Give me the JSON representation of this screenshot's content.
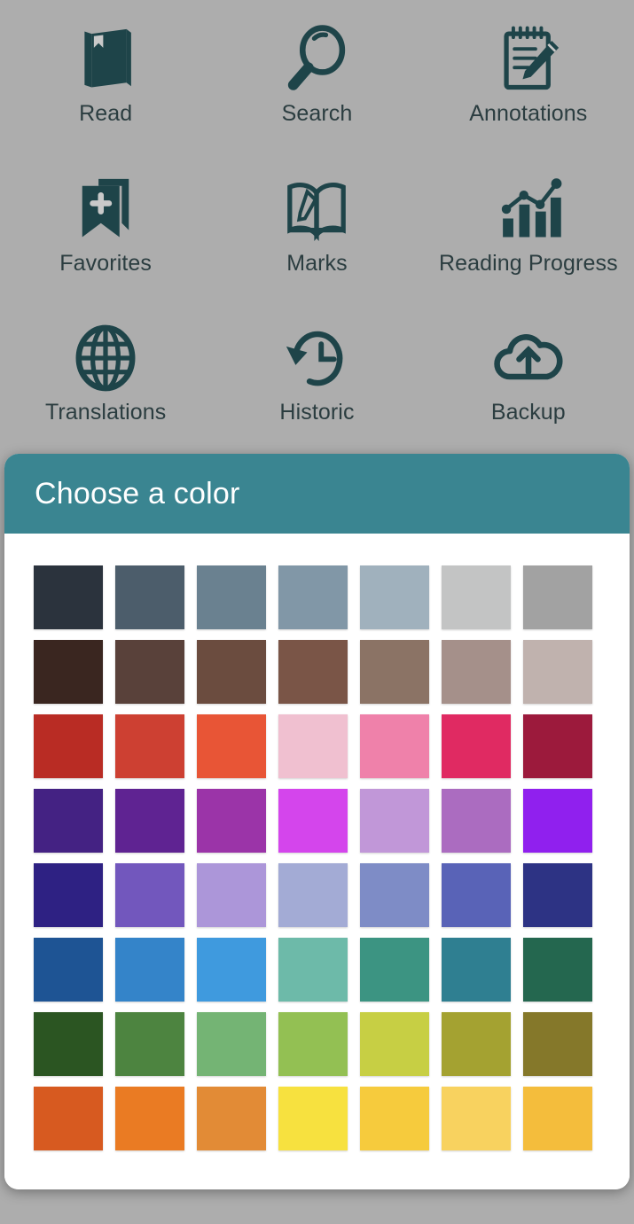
{
  "theme": {
    "background": "#adadad",
    "icon_color": "#1e4449",
    "label_color": "#2b3d40",
    "dialog_header": "#3a8591",
    "dialog_body": "#ffffff",
    "dialog_title_color": "#ffffff"
  },
  "app_menu": {
    "items": [
      {
        "label": "Read",
        "icon": "book-icon"
      },
      {
        "label": "Search",
        "icon": "magnifier-icon"
      },
      {
        "label": "Annotations",
        "icon": "notepad-pencil-icon"
      },
      {
        "label": "Favorites",
        "icon": "bookmark-plus-icon"
      },
      {
        "label": "Marks",
        "icon": "open-book-pencil-icon"
      },
      {
        "label": "Reading Progress",
        "icon": "bar-chart-trend-icon"
      },
      {
        "label": "Translations",
        "icon": "globe-icon"
      },
      {
        "label": "Historic",
        "icon": "clock-rewind-icon"
      },
      {
        "label": "Backup",
        "icon": "cloud-upload-icon"
      }
    ]
  },
  "color_dialog": {
    "title": "Choose a color",
    "columns": 7,
    "rows": 8,
    "palette": [
      [
        "#2b333d",
        "#4c5d6b",
        "#6a8190",
        "#8197a7",
        "#a0b1bd",
        "#c3c4c4",
        "#a2a2a2"
      ],
      [
        "#3a2620",
        "#59413a",
        "#6b4c3f",
        "#7a5547",
        "#8b7365",
        "#a5908a",
        "#c0b2ae"
      ],
      [
        "#b92c24",
        "#cd4032",
        "#e85536",
        "#f0c0d0",
        "#ef81aa",
        "#e02a62",
        "#9c1a3c"
      ],
      [
        "#442283",
        "#5f2392",
        "#9b34a8",
        "#d445ec",
        "#c197d8",
        "#ab6cc0",
        "#9020ee"
      ],
      [
        "#2e2183",
        "#7257bd",
        "#ac96d9",
        "#a3abd5",
        "#7e8cc6",
        "#5963b7",
        "#2d3384"
      ],
      [
        "#1e5494",
        "#3484c9",
        "#3f9ade",
        "#6dbaa9",
        "#3c9482",
        "#2f7f91",
        "#24674f"
      ],
      [
        "#2b5522",
        "#4d8440",
        "#74b474",
        "#93c053",
        "#c7cf44",
        "#a4a231",
        "#85782a"
      ],
      [
        "#d75a20",
        "#ea7b23",
        "#e28b36",
        "#f7e13f",
        "#f6cb3d",
        "#f8d25f",
        "#f4bd3c"
      ]
    ]
  }
}
